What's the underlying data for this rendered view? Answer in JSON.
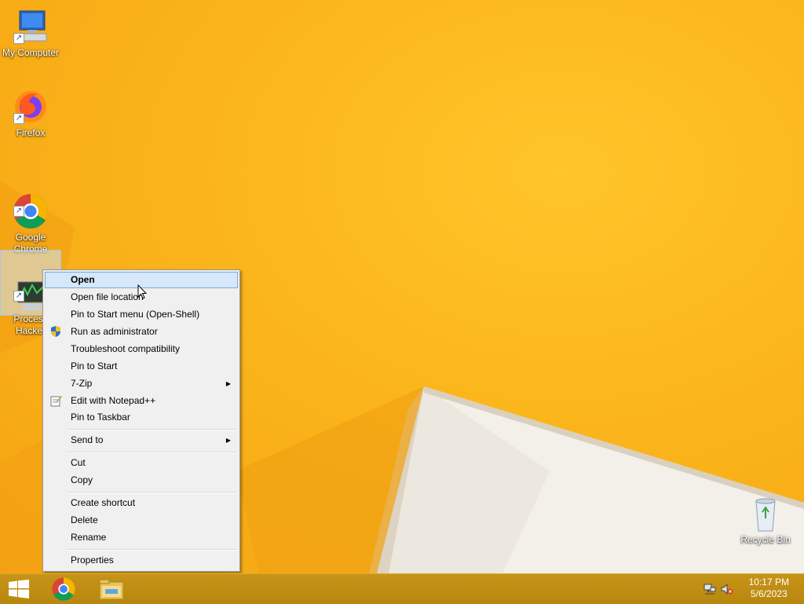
{
  "desktop": {
    "icons": [
      {
        "label": "My Computer"
      },
      {
        "label": "Firefox"
      },
      {
        "label": "Google\nChrome"
      },
      {
        "label": "Process\nHacker"
      },
      {
        "label": "Recycle Bin"
      }
    ]
  },
  "context_menu": {
    "items": [
      {
        "label": "Open",
        "bold": true,
        "highlighted": true
      },
      {
        "label": "Open file location"
      },
      {
        "label": "Pin to Start menu (Open-Shell)"
      },
      {
        "label": "Run as administrator",
        "icon": "uac-shield-icon"
      },
      {
        "label": "Troubleshoot compatibility"
      },
      {
        "label": "Pin to Start"
      },
      {
        "label": "7-Zip",
        "submenu": true
      },
      {
        "label": "Edit with Notepad++",
        "icon": "notepadpp-icon"
      },
      {
        "label": "Pin to Taskbar"
      },
      {
        "label": "Send to",
        "submenu": true
      },
      {
        "label": "Cut"
      },
      {
        "label": "Copy"
      },
      {
        "label": "Create shortcut"
      },
      {
        "label": "Delete"
      },
      {
        "label": "Rename"
      },
      {
        "label": "Properties"
      }
    ]
  },
  "taskbar": {
    "pinned": [
      {
        "icon": "windows-start-icon"
      },
      {
        "icon": "chrome-icon"
      },
      {
        "icon": "file-explorer-icon"
      }
    ],
    "tray": {
      "network_icon": "network-icon",
      "volume_icon": "volume-muted-icon"
    },
    "clock": {
      "time": "10:17 PM",
      "date": "5/6/2023"
    }
  },
  "colors": {
    "wallpaper": "#f7b21a",
    "taskbar": "#bd8c12",
    "menu_bg": "#f0f0f0",
    "highlight": "#d5e7f8"
  }
}
